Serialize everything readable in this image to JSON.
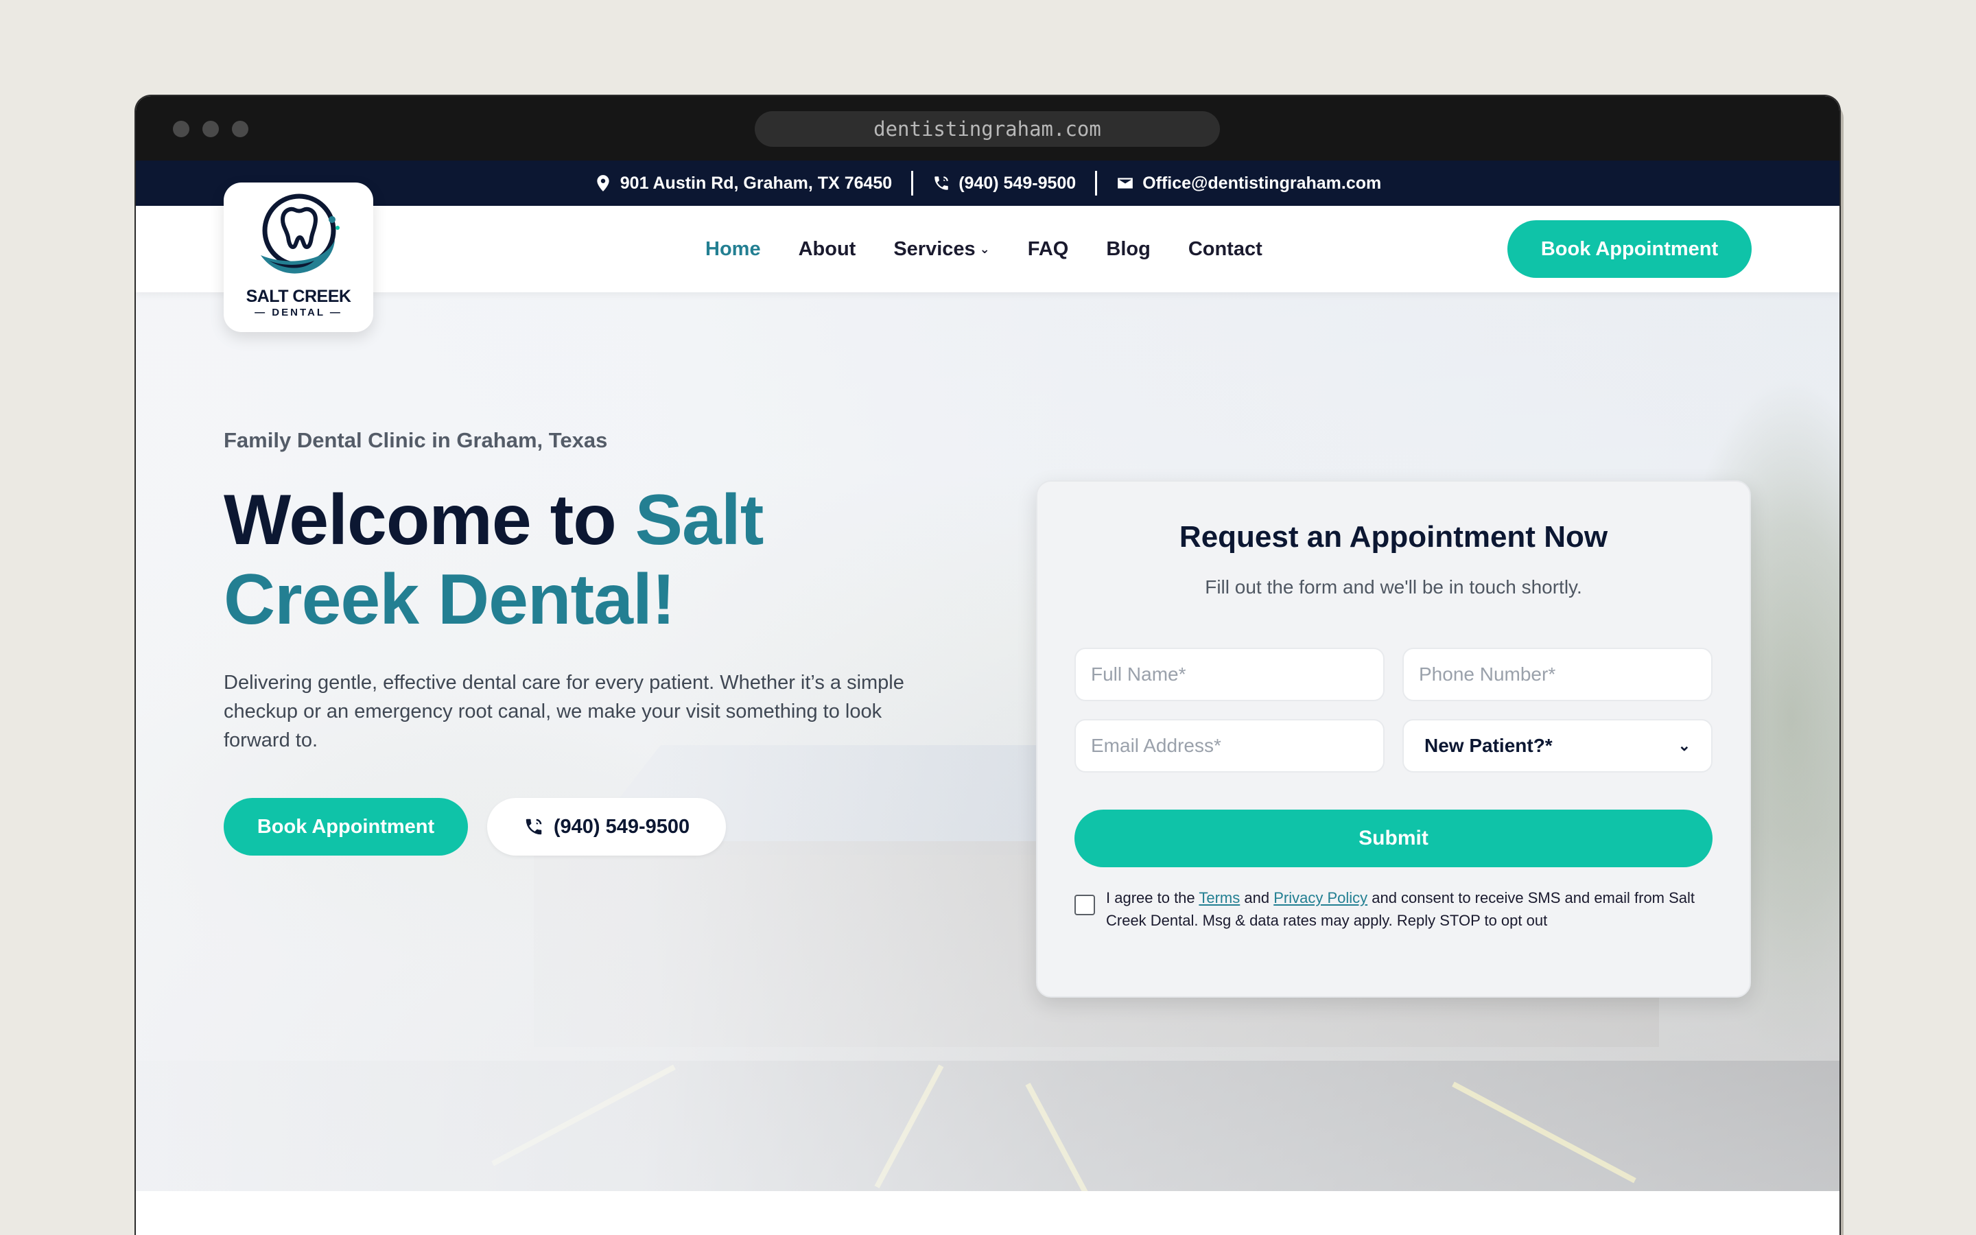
{
  "browser": {
    "url": "dentistingraham.com"
  },
  "topbar": {
    "address": "901 Austin Rd, Graham, TX 76450",
    "phone": "(940) 549-9500",
    "email": "Office@dentistingraham.com"
  },
  "logo": {
    "line1": "SALT CREEK",
    "line2": "— DENTAL —"
  },
  "nav": {
    "items": [
      {
        "label": "Home",
        "active": true
      },
      {
        "label": "About"
      },
      {
        "label": "Services",
        "has_dropdown": true
      },
      {
        "label": "FAQ"
      },
      {
        "label": "Blog"
      },
      {
        "label": "Contact"
      }
    ],
    "book_label": "Book Appointment"
  },
  "hero": {
    "eyebrow": "Family Dental Clinic in Graham, Texas",
    "headline_part1": "Welcome to ",
    "headline_accent": "Salt Creek Dental!",
    "lede": "Delivering gentle, effective dental care for every patient. Whether it’s a simple checkup or an emergency root canal, we make your visit something to look forward to.",
    "book_label": "Book Appointment",
    "phone_label": "(940) 549-9500"
  },
  "form": {
    "title": "Request an Appointment Now",
    "subtitle": "Fill out the form and we'll be in touch shortly.",
    "full_name_placeholder": "Full Name*",
    "phone_placeholder": "Phone Number*",
    "email_placeholder": "Email Address*",
    "new_patient_value": "New Patient?*",
    "submit_label": "Submit",
    "consent_prefix": "I agree to the ",
    "terms_label": "Terms",
    "consent_and": " and ",
    "privacy_label": "Privacy Policy",
    "consent_suffix": " and consent to receive SMS and email from Salt Creek Dental. Msg & data rates may apply. Reply STOP to opt out"
  },
  "colors": {
    "accent_teal": "#0fc3a8",
    "brand_blue": "#237f92",
    "navy": "#0c1732"
  },
  "icons": [
    "map-pin-icon",
    "phone-icon",
    "mail-icon",
    "chevron-down-icon",
    "tooth-logo-icon"
  ]
}
